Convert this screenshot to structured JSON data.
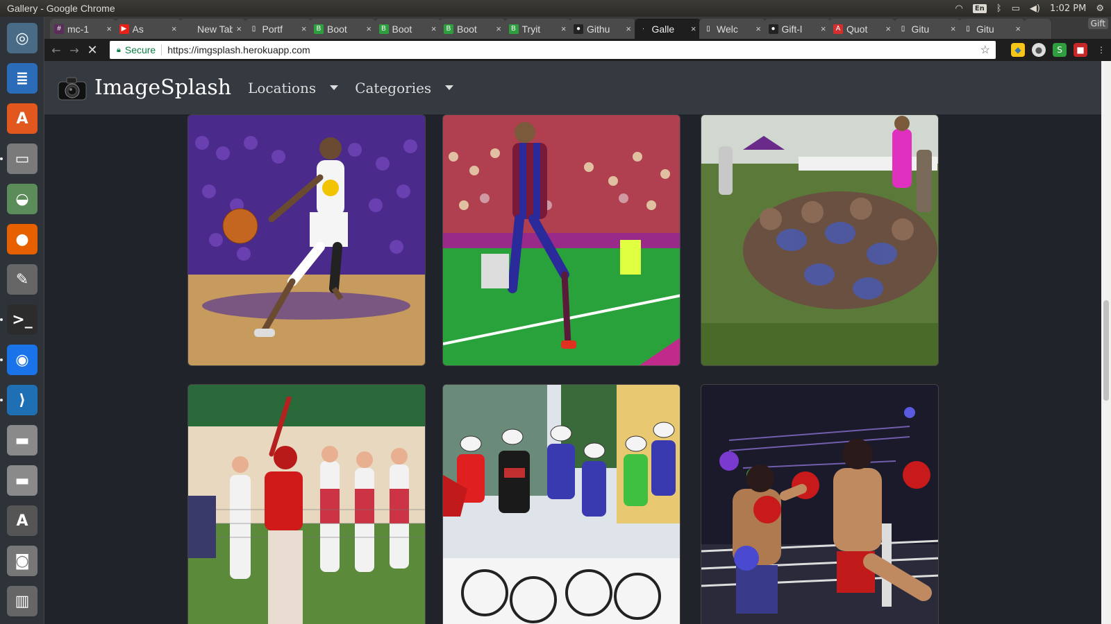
{
  "window": {
    "title": "Gallery - Google Chrome"
  },
  "system": {
    "keyboard": "En",
    "time": "1:02 PM"
  },
  "launcher": [
    {
      "name": "ubuntu-dash-icon",
      "glyph": "◎",
      "bg": "#4a6b86"
    },
    {
      "name": "writer-icon",
      "glyph": "≣",
      "bg": "#2a6cb8"
    },
    {
      "name": "software-center-icon",
      "glyph": "A",
      "bg": "#e2571e"
    },
    {
      "name": "files-icon",
      "glyph": "▭",
      "bg": "#7a7a7a"
    },
    {
      "name": "disk-usage-icon",
      "glyph": "◒",
      "bg": "#5b8c5a"
    },
    {
      "name": "firefox-icon",
      "glyph": "●",
      "bg": "#e66000"
    },
    {
      "name": "settings-icon",
      "glyph": "✎",
      "bg": "#666"
    },
    {
      "name": "terminal-icon",
      "glyph": ">_",
      "bg": "#2c2c2c"
    },
    {
      "name": "chrome-icon",
      "glyph": "◉",
      "bg": "#1a73e8"
    },
    {
      "name": "vscode-icon",
      "glyph": "⟩",
      "bg": "#1f6fb5"
    },
    {
      "name": "disk-drive-icon",
      "glyph": "▬",
      "bg": "#8a8a8a"
    },
    {
      "name": "disk-drive-icon-2",
      "glyph": "▬",
      "bg": "#8a8a8a"
    },
    {
      "name": "updater-icon",
      "glyph": "A",
      "bg": "#555"
    },
    {
      "name": "camera-app-icon",
      "glyph": "◙",
      "bg": "#777"
    },
    {
      "name": "trash-icon",
      "glyph": "▥",
      "bg": "#666"
    }
  ],
  "tabs": [
    {
      "label": "mc-1",
      "fav": "#",
      "favbg": "#5a2d5a"
    },
    {
      "label": "As",
      "fav": "▶",
      "favbg": "#e62117"
    },
    {
      "label": "New Tab",
      "fav": "",
      "favbg": "transparent"
    },
    {
      "label": "Portf",
      "fav": "▯",
      "favbg": "transparent"
    },
    {
      "label": "Boot",
      "fav": "B",
      "favbg": "#2e9e3e"
    },
    {
      "label": "Boot",
      "fav": "B",
      "favbg": "#2e9e3e"
    },
    {
      "label": "Boot",
      "fav": "B",
      "favbg": "#2e9e3e"
    },
    {
      "label": "Tryit",
      "fav": "B",
      "favbg": "#2e9e3e"
    },
    {
      "label": "Githu",
      "fav": "●",
      "favbg": "#222"
    },
    {
      "label": "Galle",
      "fav": "·",
      "favbg": "transparent"
    },
    {
      "label": "Welc",
      "fav": "▯",
      "favbg": "transparent"
    },
    {
      "label": "Gift-l",
      "fav": "●",
      "favbg": "#222"
    },
    {
      "label": "Quot",
      "fav": "A",
      "favbg": "#d32f2f"
    },
    {
      "label": "Gitu",
      "fav": "▯",
      "favbg": "transparent"
    },
    {
      "label": "Gitu",
      "fav": "▯",
      "favbg": "transparent"
    }
  ],
  "gift_label": "Gift",
  "omnibox": {
    "secure": "Secure",
    "url": "https://imgsplash.herokuapp.com"
  },
  "site": {
    "brand": "ImageSplash",
    "nav": [
      {
        "label": "Locations"
      },
      {
        "label": "Categories"
      }
    ]
  },
  "gallery": [
    {
      "name": "basketball-image",
      "subject": "basketball"
    },
    {
      "name": "soccer-image",
      "subject": "soccer"
    },
    {
      "name": "rugby-image",
      "subject": "rugby"
    },
    {
      "name": "baseball-image",
      "subject": "baseball"
    },
    {
      "name": "cycling-image",
      "subject": "cycling"
    },
    {
      "name": "boxing-image",
      "subject": "boxing"
    }
  ]
}
